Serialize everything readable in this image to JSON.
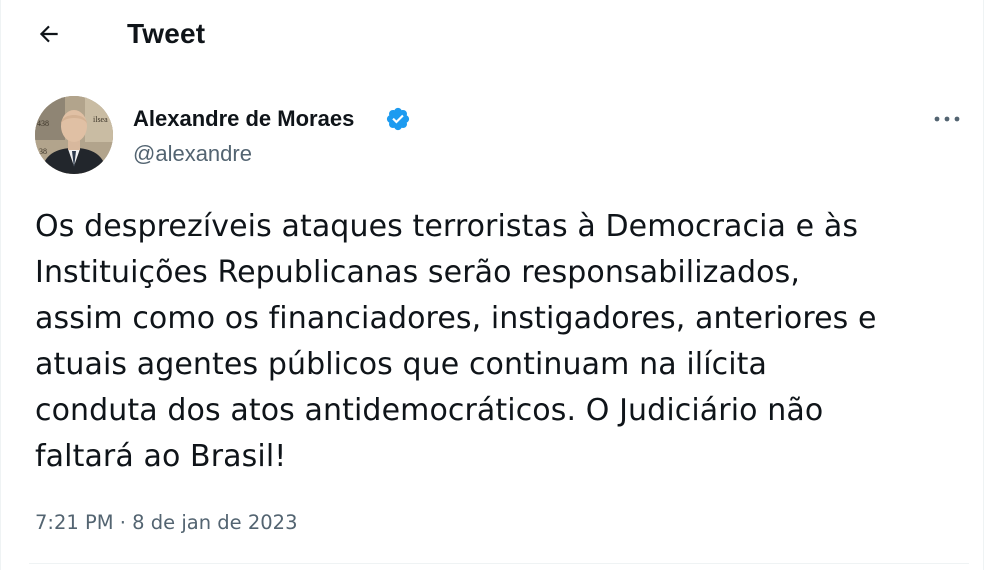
{
  "header": {
    "title": "Tweet",
    "back_icon": "arrow-left-icon"
  },
  "tweet": {
    "author": {
      "name": "Alexandre de Moraes",
      "handle": "@alexandre",
      "verified": true,
      "verified_icon": "verified-badge-icon",
      "verified_color": "#1d9bf0"
    },
    "text": "Os desprezíveis ataques terroristas à Democracia e às\nInstituições Republicanas serão responsabilizados,\nassim como os financiadores, instigadores, anteriores e\natuais agentes públicos que continuam na ilícita\nconduta dos atos antidemocráticos. O Judiciário não\nfaltará ao Brasil!",
    "timestamp": "7:21 PM · 8 de jan de 2023",
    "more_icon": "more-dots-icon"
  },
  "colors": {
    "text_primary": "#0f1419",
    "text_secondary": "#536471",
    "accent": "#1d9bf0",
    "border": "#eff3f4"
  }
}
